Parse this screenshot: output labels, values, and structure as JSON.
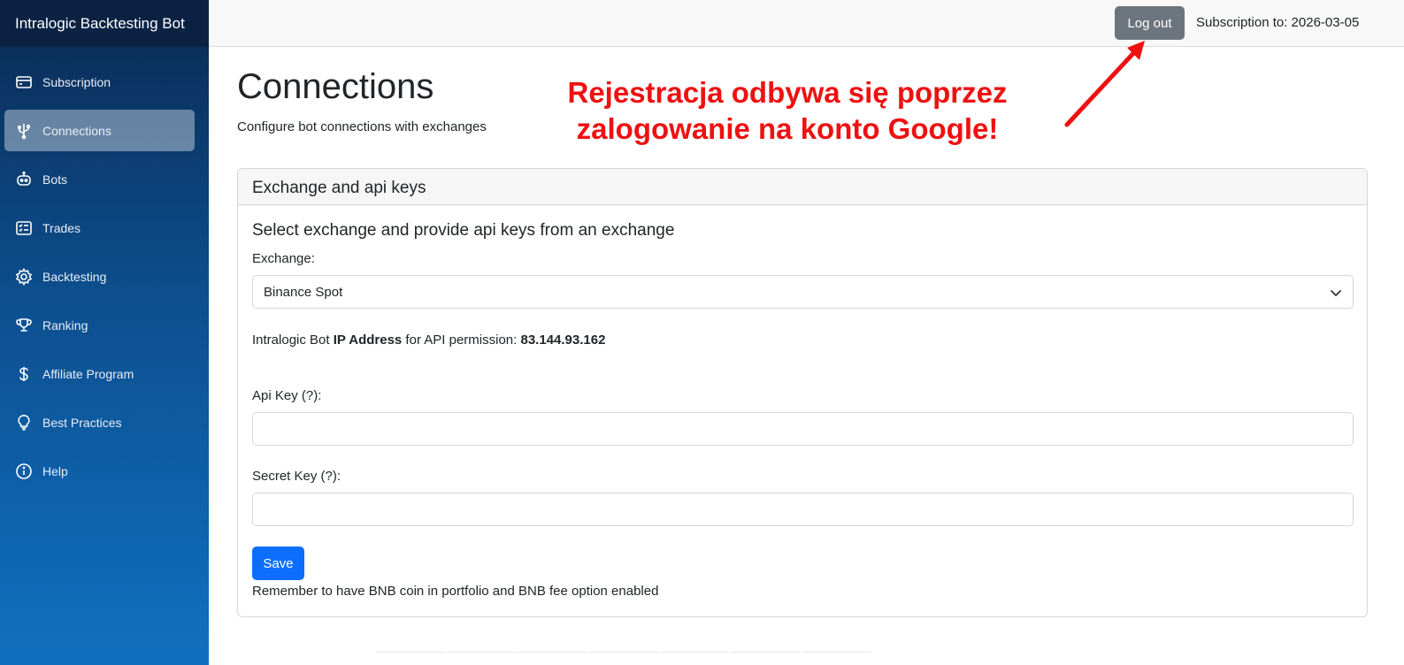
{
  "brand": "Intralogic Backtesting Bot",
  "sidebar": {
    "items": [
      {
        "label": "Subscription",
        "icon": "credit-card-icon",
        "active": false
      },
      {
        "label": "Connections",
        "icon": "usb-plug-icon",
        "active": true
      },
      {
        "label": "Bots",
        "icon": "robot-icon",
        "active": false
      },
      {
        "label": "Trades",
        "icon": "list-check-icon",
        "active": false
      },
      {
        "label": "Backtesting",
        "icon": "gear-icon",
        "active": false
      },
      {
        "label": "Ranking",
        "icon": "trophy-icon",
        "active": false
      },
      {
        "label": "Affiliate Program",
        "icon": "dollar-icon",
        "active": false
      },
      {
        "label": "Best Practices",
        "icon": "lightbulb-icon",
        "active": false
      },
      {
        "label": "Help",
        "icon": "info-icon",
        "active": false
      }
    ]
  },
  "topbar": {
    "logout_label": "Log out",
    "subscription_text": "Subscription to: 2026-03-05"
  },
  "page": {
    "title": "Connections",
    "subtitle": "Configure bot connections with exchanges"
  },
  "annotation": {
    "line1": "Rejestracja odbywa się poprzez",
    "line2": "zalogowanie na konto Google!"
  },
  "card": {
    "header": "Exchange and api keys",
    "title": "Select exchange and provide api keys from an exchange",
    "exchange_label": "Exchange:",
    "exchange_value": "Binance Spot",
    "ip_prefix": "Intralogic Bot ",
    "ip_bold": "IP Address",
    "ip_middle": " for API permission: ",
    "ip_value": "83.144.93.162",
    "api_key_label": "Api Key (?):",
    "api_key_value": "",
    "secret_key_label": "Secret Key (?):",
    "secret_key_value": "",
    "save_label": "Save",
    "note": "Remember to have BNB coin in portfolio and BNB fee option enabled"
  },
  "colors": {
    "accent": "#0d6efd",
    "annotation": "#ee1111",
    "logout": "#6c757d"
  }
}
